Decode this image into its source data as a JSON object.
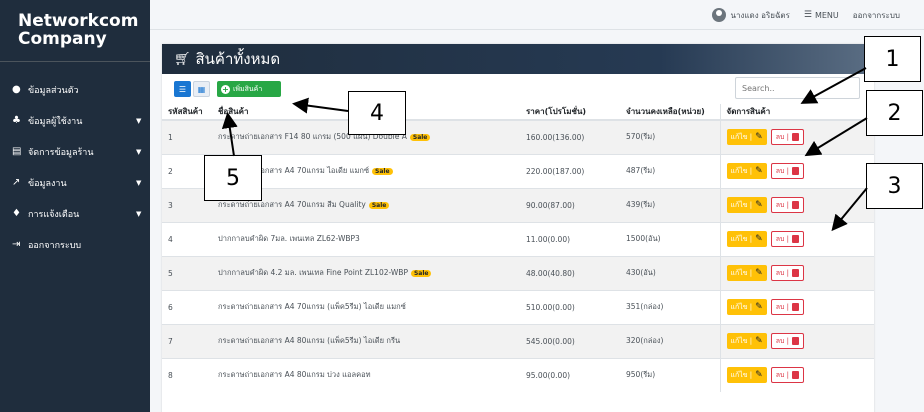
{
  "brand": {
    "name_line1": "Networkcom",
    "name_line2": "Company"
  },
  "sidebar": {
    "items": [
      {
        "icon": "user-circle-icon",
        "glyph": "●",
        "label": "ข้อมูลส่วนตัว",
        "caret": false
      },
      {
        "icon": "users-icon",
        "glyph": "♣",
        "label": "ข้อมูลผู้ใช้งาน",
        "caret": true
      },
      {
        "icon": "file-icon",
        "glyph": "▤",
        "label": "จัดการข้อมูลร้าน",
        "caret": true
      },
      {
        "icon": "chart-line-icon",
        "glyph": "↗",
        "label": "ข้อมูลงาน",
        "caret": true
      },
      {
        "icon": "bell-icon",
        "glyph": "♦",
        "label": "การแจ้งเตือน",
        "caret": true
      },
      {
        "icon": "logout-icon",
        "glyph": "⇥",
        "label": "ออกจากระบบ",
        "caret": false
      }
    ]
  },
  "topbar": {
    "user_name": "นางแดง อริยฉัตร",
    "menu_label": "MENU",
    "logout_label": "ออกจากระบบ"
  },
  "card": {
    "title": "สินค้าทั้งหมด"
  },
  "toolbar": {
    "add_label": "เพิ่มสินค้า",
    "search_placeholder": "Search.."
  },
  "table": {
    "headers": [
      "รหัสสินค้า",
      "ชื่อสินค้า",
      "ราคา(โปรโมชั่น)",
      "จำนวนคงเหลือ(หน่วย)",
      "จัดการสินค้า"
    ],
    "edit_label": "แก้ไข |",
    "delete_label": "ลบ |",
    "sale_label": "Sale",
    "rows": [
      {
        "id": "1",
        "name": "กระดาษถ่ายเอกสาร F14 80 แกรม (500 แผ่น) Double A",
        "sale": true,
        "price": "160.00(136.00)",
        "stock": "570(รีม)"
      },
      {
        "id": "2",
        "name": "กระดาษถ่ายเอกสาร A4 70แกรม ไอเดีย แมกซ์",
        "sale": true,
        "price": "220.00(187.00)",
        "stock": "487(รีม)"
      },
      {
        "id": "3",
        "name": "กระดาษถ่ายเอกสาร A4 70แกรม สีม Quality",
        "sale": true,
        "price": "90.00(87.00)",
        "stock": "439(รีม)"
      },
      {
        "id": "4",
        "name": "ปากกาลบคำผิด 7มล. เพนเทล ZL62-WBP3",
        "sale": false,
        "price": "11.00(0.00)",
        "stock": "1500(อัน)"
      },
      {
        "id": "5",
        "name": "ปากกาลบคำผิด 4.2 มล. เพนเทล Fine Point ZL102-WBP",
        "sale": true,
        "price": "48.00(40.80)",
        "stock": "430(อัน)"
      },
      {
        "id": "6",
        "name": "กระดาษถ่ายเอกสาร A4 70แกรม (แพ็ค5รีม) ไอเดีย แมกซ์",
        "sale": false,
        "price": "510.00(0.00)",
        "stock": "351(กล่อง)"
      },
      {
        "id": "7",
        "name": "กระดาษถ่ายเอกสาร A4 80แกรม (แพ็ค5รีม) ไอเดีย กรีน",
        "sale": false,
        "price": "545.00(0.00)",
        "stock": "320(กล่อง)"
      },
      {
        "id": "8",
        "name": "กระดาษถ่ายเอกสาร A4 80แกรม บ่วง แอลคอท",
        "sale": false,
        "price": "95.00(0.00)",
        "stock": "950(รีม)"
      }
    ]
  },
  "annotations": [
    "1",
    "2",
    "3",
    "4",
    "5"
  ],
  "colors": {
    "sidebar": "#1f2d3d",
    "primary": "#1976d2",
    "success": "#28a745",
    "warning": "#ffc107",
    "danger": "#dc3545"
  }
}
